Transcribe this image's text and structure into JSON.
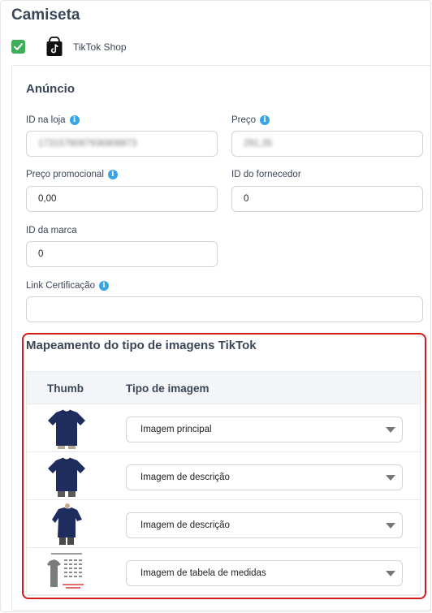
{
  "product": {
    "title": "Camiseta"
  },
  "channel": {
    "name": "TikTok Shop",
    "checked": true,
    "icon": "tiktok-icon"
  },
  "ad": {
    "section_title": "Anúncio",
    "fields": {
      "store_id": {
        "label": "ID na loja",
        "value": "1731578087936908873",
        "redacted": true
      },
      "price": {
        "label": "Preço",
        "value": "291,35",
        "redacted": true
      },
      "promo_price": {
        "label": "Preço promocional",
        "value": "0,00"
      },
      "supplier_id": {
        "label": "ID do fornecedor",
        "value": "0"
      },
      "brand_id": {
        "label": "ID da marca",
        "value": "0"
      },
      "cert_link": {
        "label": "Link Certificação",
        "value": ""
      }
    }
  },
  "mapping": {
    "title": "Mapeamento do tipo de imagens TikTok",
    "columns": [
      "Thumb",
      "Tipo de imagem"
    ],
    "rows": [
      {
        "thumb": "navy-tshirt-front",
        "type": "Imagem principal"
      },
      {
        "thumb": "navy-tshirt-front",
        "type": "Imagem de descrição"
      },
      {
        "thumb": "navy-tshirt-side",
        "type": "Imagem de descrição"
      },
      {
        "thumb": "size-chart",
        "type": "Imagem de tabela de medidas"
      }
    ]
  },
  "colors": {
    "accent_check": "#3fae5a",
    "highlight_border": "#d11a1a",
    "info": "#3aa3e3"
  }
}
